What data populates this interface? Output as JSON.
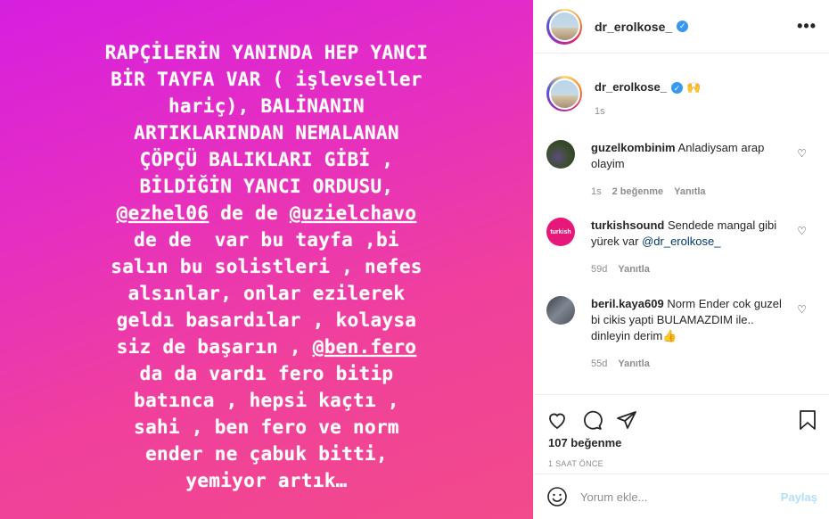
{
  "story": {
    "lines": [
      {
        "text": "RAPÇİLERİN YANINDA HEP YANCI"
      },
      {
        "text": "BİR TAYFA VAR ( işlevseller"
      },
      {
        "text": "hariç), BALİNANIN"
      },
      {
        "text": "ARTIKLARINDAN NEMALANAN"
      },
      {
        "text": "ÇÖPÇÜ BALIKLARI GİBİ ,"
      },
      {
        "text": "BİLDİĞİN YANCI ORDUSU,"
      },
      {
        "m1": "@ezhel06",
        "mid": " de de ",
        "m2": "@uzielchavo"
      },
      {
        "text": "de de  var bu tayfa ,bi"
      },
      {
        "text": "salın bu solistleri , nefes"
      },
      {
        "text": "alsınlar, onlar ezilerek"
      },
      {
        "text": "geldı basardılar , kolaysa"
      },
      {
        "pre": "siz de başarın , ",
        "m1": "@ben.fero"
      },
      {
        "text": "da da vardı fero bitip"
      },
      {
        "text": "batınca , hepsi kaçtı ,"
      },
      {
        "text": "sahi , ben fero ve norm"
      },
      {
        "text": "ender ne çabuk bitti,"
      },
      {
        "text": "yemiyor artık…"
      }
    ]
  },
  "header": {
    "username": "dr_erolkose_",
    "more": "•••"
  },
  "caption": {
    "username": "dr_erolkose_",
    "emoji": "🙌",
    "time": "1s"
  },
  "comments": [
    {
      "username": "guzelkombinim",
      "text": "Anladiysam arap olayim",
      "time": "1s",
      "likes": "2 beğenme",
      "reply": "Yanıtla",
      "avatar_color": "#3d4a2e"
    },
    {
      "username": "turkishsound",
      "text": "Sendede mangal gibi yürek var ",
      "mention": "@dr_erolkose_",
      "time": "59d",
      "reply": "Yanıtla",
      "avatar_color": "#e6197a",
      "avatar_label": "turkish"
    },
    {
      "username": "beril.kaya609",
      "text": "Norm Ender cok guzel bi cikis yapti BULAMAZDIM ile.. dinleyin derim👍",
      "time": "55d",
      "reply": "Yanıtla",
      "avatar_color": "#5a6068"
    }
  ],
  "actions": {
    "likes": "107 beğenme",
    "time": "1 SAAT ÖNCE",
    "comment_placeholder": "Yorum ekle...",
    "post_label": "Paylaş"
  }
}
